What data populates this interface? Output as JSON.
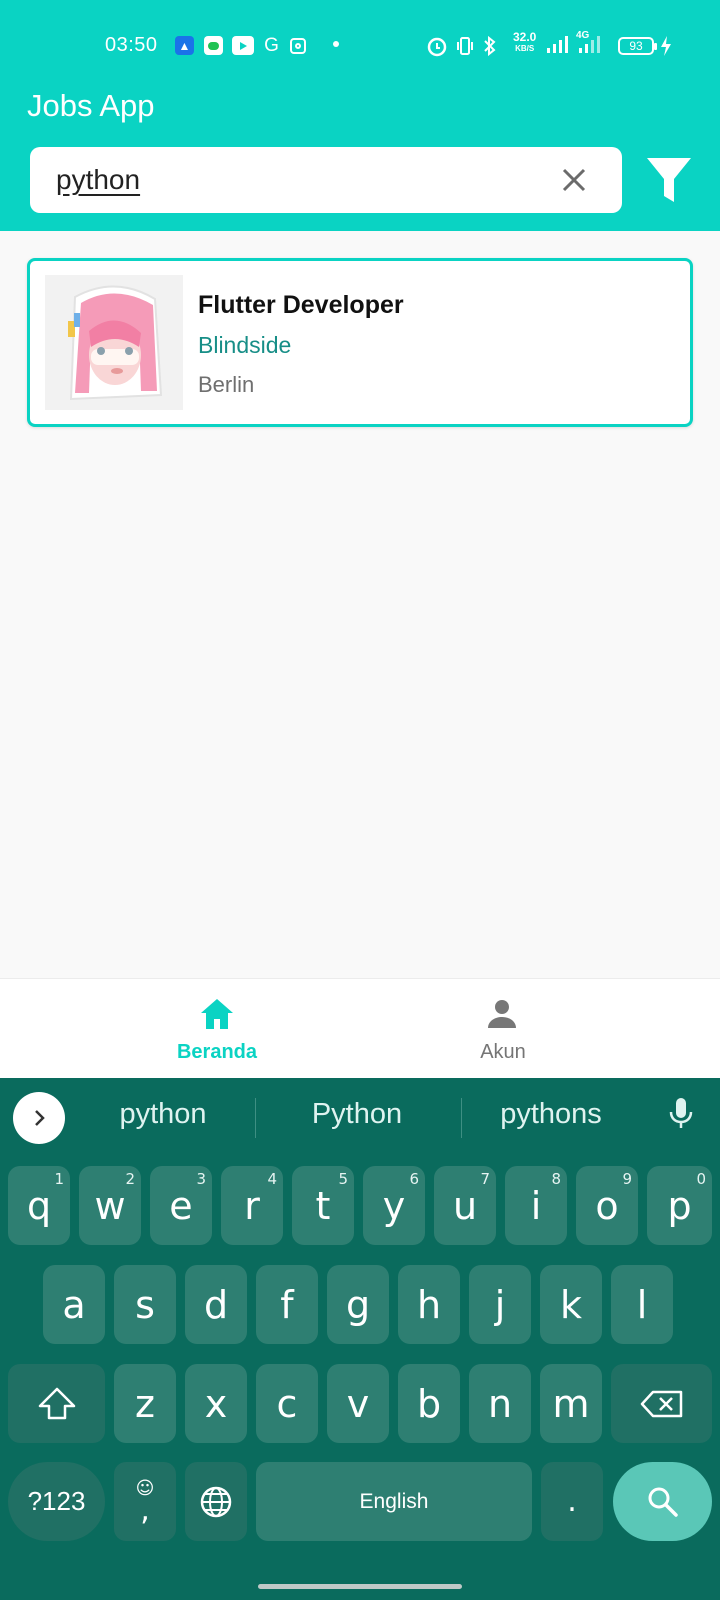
{
  "status_bar": {
    "time": "03:50",
    "net_speed": "32.0",
    "net_unit": "KB/S",
    "network": "4G",
    "battery": "93",
    "icons": [
      "android-icon",
      "chat-icon",
      "youtube-icon",
      "g-icon",
      "instagram-icon",
      "dot-icon",
      "alarm-icon",
      "vibrate-icon",
      "bluetooth-icon",
      "signal-icon",
      "battery-icon",
      "charging-icon"
    ]
  },
  "app": {
    "title": "Jobs App",
    "accent_color": "#0ad3c3"
  },
  "search": {
    "value": "python",
    "clear_icon": "close-icon",
    "filter_icon": "filter-icon"
  },
  "jobs": [
    {
      "title": "Flutter Developer",
      "company": "Blindside",
      "location": "Berlin",
      "thumbnail": "anime-girl-sticker"
    }
  ],
  "bottom_nav": {
    "items": [
      {
        "label": "Beranda",
        "icon": "home-icon",
        "active": true
      },
      {
        "label": "Akun",
        "icon": "person-icon",
        "active": false
      }
    ]
  },
  "keyboard": {
    "suggestions": [
      "python",
      "Python",
      "pythons"
    ],
    "row1": [
      "q",
      "w",
      "e",
      "r",
      "t",
      "y",
      "u",
      "i",
      "o",
      "p"
    ],
    "row1_hints": [
      "1",
      "2",
      "3",
      "4",
      "5",
      "6",
      "7",
      "8",
      "9",
      "0"
    ],
    "row2": [
      "a",
      "s",
      "d",
      "f",
      "g",
      "h",
      "j",
      "k",
      "l"
    ],
    "row3": [
      "z",
      "x",
      "c",
      "v",
      "b",
      "n",
      "m"
    ],
    "symbols_label": "?123",
    "comma_label": ",",
    "space_label": "English",
    "period_label": "."
  }
}
